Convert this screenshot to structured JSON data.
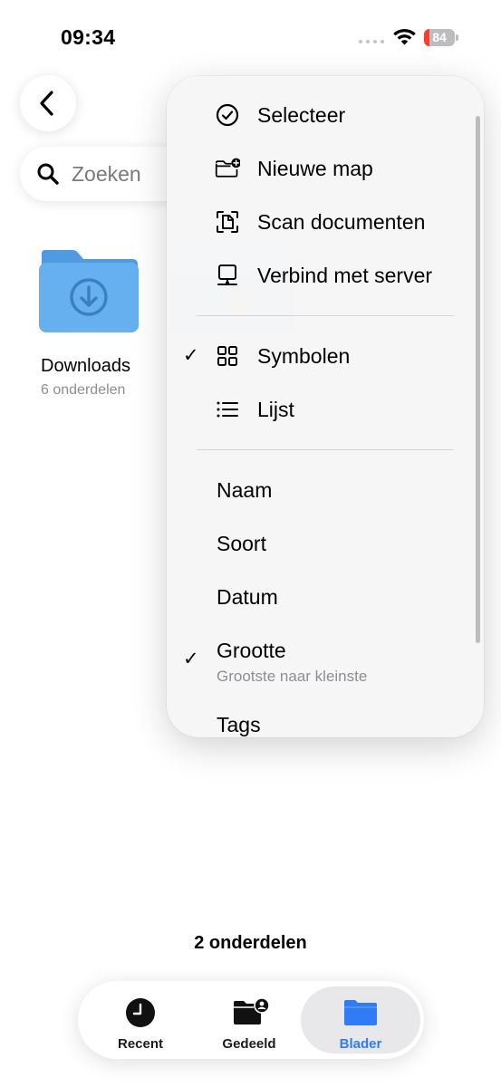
{
  "status_bar": {
    "time": "09:34",
    "battery_level": "84",
    "battery_percent": 84,
    "battery_color": "#ff3b30"
  },
  "navigation": {
    "back_icon": "chevron-left-icon"
  },
  "search": {
    "placeholder": "Zoeken",
    "icon": "magnifying-glass-icon"
  },
  "folders": [
    {
      "name": "Downloads",
      "count": "6 onderdelen",
      "icon": "download-folder-icon",
      "color": "#5fa8e8"
    }
  ],
  "menu": {
    "actions": [
      {
        "label": "Selecteer",
        "icon": "checkmark-circle-icon"
      },
      {
        "label": "Nieuwe map",
        "icon": "folder-badge-plus-icon"
      },
      {
        "label": "Scan documenten",
        "icon": "doc-viewfinder-icon"
      },
      {
        "label": "Verbind met server",
        "icon": "display-server-icon"
      }
    ],
    "view_options": [
      {
        "label": "Symbolen",
        "icon": "grid-icon",
        "checked": true
      },
      {
        "label": "Lijst",
        "icon": "list-icon",
        "checked": false
      }
    ],
    "sort_options": [
      {
        "label": "Naam",
        "checked": false
      },
      {
        "label": "Soort",
        "checked": false
      },
      {
        "label": "Datum",
        "checked": false
      },
      {
        "label": "Grootte",
        "checked": true,
        "sublabel": "Grootste naar kleinste"
      },
      {
        "label": "Tags",
        "checked": false
      }
    ],
    "check_mark": "✓"
  },
  "footer": {
    "items_count": "2 onderdelen"
  },
  "tab_bar": {
    "tabs": [
      {
        "label": "Recent",
        "icon": "clock-icon",
        "selected": false
      },
      {
        "label": "Gedeeld",
        "icon": "shared-folder-icon",
        "selected": false
      },
      {
        "label": "Blader",
        "icon": "folder-icon",
        "selected": true
      }
    ],
    "accent_color": "#2f7cf6"
  }
}
